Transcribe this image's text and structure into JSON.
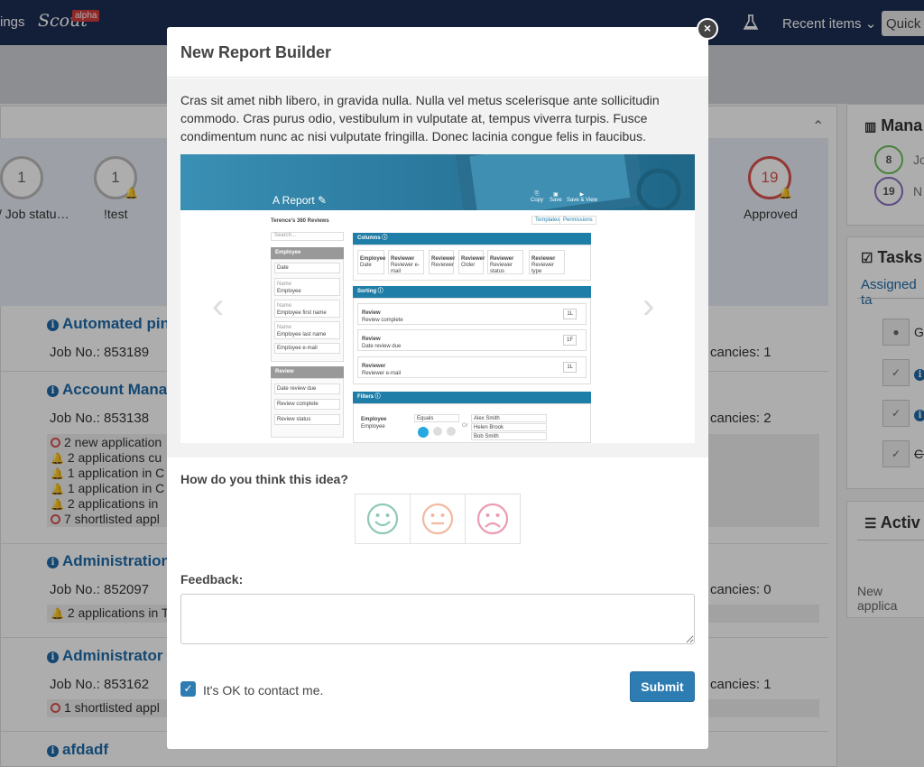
{
  "nav": {
    "settings_partial": "ings",
    "logo": "Scout",
    "badge": "alpha",
    "recent_items": "Recent items ⌄",
    "quick": "Quick s"
  },
  "stats": [
    {
      "value": "1",
      "label": "/ Job statu…",
      "color": "#bbbbbb"
    },
    {
      "value": "1",
      "label": "!test",
      "color": "#bbbbbb"
    },
    {
      "value": "19",
      "label": "Approved",
      "color": "#d9534f"
    }
  ],
  "jobs": [
    {
      "title": "Automated pin",
      "job_no": "Job No.: 853189",
      "vacancies": "cancies: 1"
    },
    {
      "title": "Account Manag",
      "job_no": "Job No.: 853138",
      "vacancies": "cancies: 2",
      "alerts": [
        "2 new application",
        "2 applications cu",
        "1 application in C",
        "1 application in C",
        "2 applications in",
        "7 shortlisted appl"
      ]
    },
    {
      "title": "Administration",
      "job_no": "Job No.: 852097",
      "vacancies": "cancies: 0",
      "alerts": [
        "2 applications in T"
      ]
    },
    {
      "title": "Administrator",
      "job_no": "Job No.: 853162",
      "vacancies": "cancies: 1",
      "alerts": [
        "1 shortlisted appl"
      ]
    },
    {
      "title": "afdadf"
    }
  ],
  "right": {
    "manage_title": "Mana",
    "manage_items": [
      {
        "value": "8",
        "label": "Jo",
        "color": "#6cbf5a"
      },
      {
        "value": "19",
        "label": "N",
        "color": "#8a6fc2"
      }
    ],
    "tasks_title": "Tasks",
    "assigned": "Assigned ta",
    "task_rows": [
      "Ge",
      "",
      "",
      "Cl"
    ],
    "activity_title": "Activ",
    "activity_item": "New applica"
  },
  "modal": {
    "title": "New Report Builder",
    "close": "×",
    "description": "Cras sit amet nibh libero, in gravida nulla. Nulla vel metus scelerisque ante sollicitudin commodo. Cras purus odio, vestibulum in vulputate at, tempus viverra turpis. Fusce condimentum nunc ac nisi vulputate fringilla. Donec lacinia congue felis in faucibus.",
    "slide": {
      "report_name": "A Report",
      "tools": [
        "Copy",
        "Save",
        "Save & View"
      ],
      "subtitle": "Terence's 360 Reviews",
      "buttons": [
        "Templates",
        "Permissions"
      ],
      "search": "Search...",
      "employee_head": "Employee",
      "employee_fields": [
        "Date",
        "Employee",
        "Employee first name",
        "Employee last name",
        "Employee e-mail"
      ],
      "employee_field_labels": [
        "",
        "Name",
        "Name",
        "Name",
        ""
      ],
      "review_head": "Review",
      "review_fields": [
        "Date review due",
        "Review complete",
        "Review status"
      ],
      "columns_head": "Columns",
      "columns": [
        {
          "a": "Employee",
          "b": "Date"
        },
        {
          "a": "Reviewer",
          "b": "Reviewer e-mail"
        },
        {
          "a": "Reviewer",
          "b": "Reviewer"
        },
        {
          "a": "Reviewer",
          "b": "Order"
        },
        {
          "a": "Reviewer",
          "b": "Reviewer status"
        },
        {
          "a": "Reviewer",
          "b": "Reviewer type"
        }
      ],
      "sorting_head": "Sorting",
      "sorts": [
        {
          "a": "Review",
          "b": "Review complete",
          "c": "1L"
        },
        {
          "a": "Review",
          "b": "Date review due",
          "c": "1F"
        },
        {
          "a": "Reviewer",
          "b": "Reviewer e-mail",
          "c": "1L"
        }
      ],
      "filters_head": "Filters",
      "filter": {
        "a": "Employee",
        "b": "Employee",
        "op": "Equals",
        "values": [
          "Alex Smith",
          "Helen Brook",
          "Bob Smith"
        ],
        "or": "Or"
      }
    },
    "prev": "‹",
    "next": "›",
    "question": "How do you think this idea?",
    "faces": [
      "happy-face",
      "neutral-face",
      "sad-face"
    ],
    "face_colors": [
      "#8fc9b5",
      "#f2b9a0",
      "#ec9bb0"
    ],
    "feedback_label": "Feedback:",
    "feedback_value": "",
    "contact_label": "It's OK to contact me.",
    "contact_checked": true,
    "submit": "Submit"
  }
}
